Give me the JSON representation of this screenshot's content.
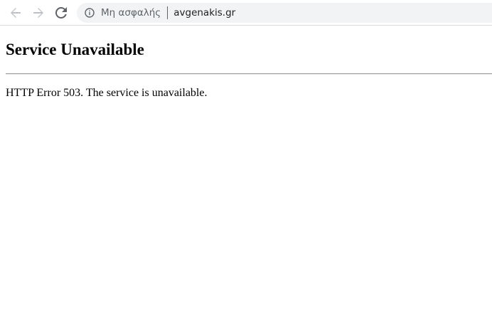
{
  "browser": {
    "security_label": "Μη ασφαλής",
    "url": "avgenakis.gr",
    "icons": {
      "back": "back-arrow-icon",
      "forward": "forward-arrow-icon",
      "reload": "reload-icon",
      "info": "info-icon"
    },
    "colors": {
      "nav_disabled": "#bdc1c6",
      "nav_active": "#5f6368",
      "omnibox_bg": "#f1f3f4"
    }
  },
  "page": {
    "title": "Service Unavailable",
    "message": "HTTP Error 503. The service is unavailable."
  }
}
